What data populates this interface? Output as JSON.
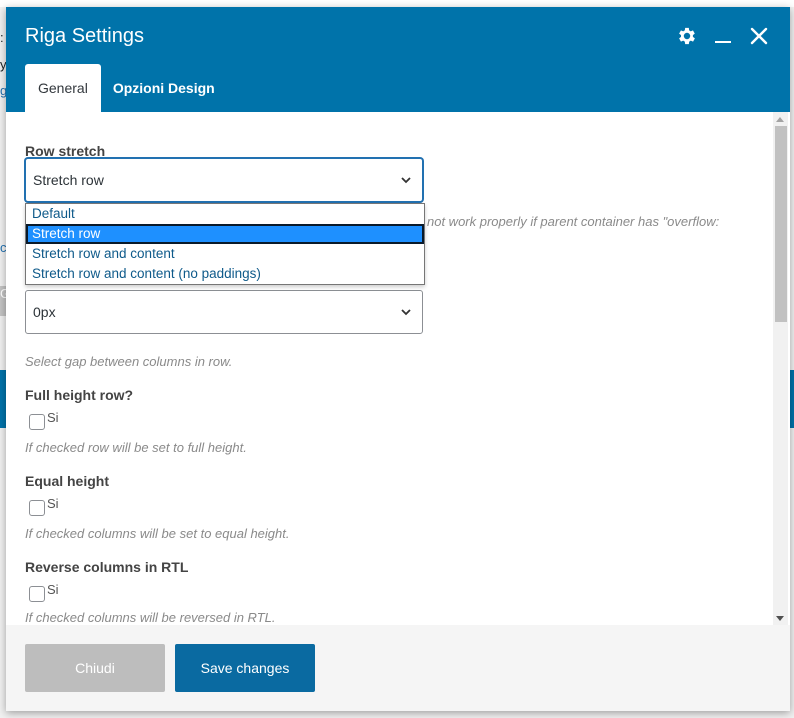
{
  "background": {
    "fragments": [
      ":",
      "y",
      "g",
      "c",
      "G"
    ]
  },
  "modal": {
    "title": "Riga Settings",
    "tabs": [
      {
        "label": "General",
        "active": true
      },
      {
        "label": "Opzioni Design",
        "active": false
      }
    ],
    "header_icons": [
      "gear-icon",
      "minimize-icon",
      "close-icon"
    ]
  },
  "colors": {
    "header": "#0073aa",
    "save_button": "#0a6aa1",
    "close_button": "#bdbdbd",
    "selected_option": "#1e90ff"
  },
  "fields": {
    "row_stretch": {
      "label": "Row stretch",
      "value": "Stretch row",
      "options": [
        "Default",
        "Stretch row",
        "Stretch row and content",
        "Stretch row and content (no paddings)"
      ],
      "help_trailing": "not work properly if parent container has \"overflow:"
    },
    "columns_gap": {
      "value": "0px",
      "help": "Select gap between columns in row."
    },
    "full_height": {
      "label": "Full height row?",
      "checkbox_label": "Si",
      "checked": false,
      "help": "If checked row will be set to full height."
    },
    "equal_height": {
      "label": "Equal height",
      "checkbox_label": "Si",
      "checked": false,
      "help": "If checked columns will be set to equal height."
    },
    "reverse_rtl": {
      "label": "Reverse columns in RTL",
      "checkbox_label": "Si",
      "checked": false,
      "help": "If checked columns will be reversed in RTL."
    }
  },
  "footer": {
    "close_label": "Chiudi",
    "save_label": "Save changes"
  }
}
